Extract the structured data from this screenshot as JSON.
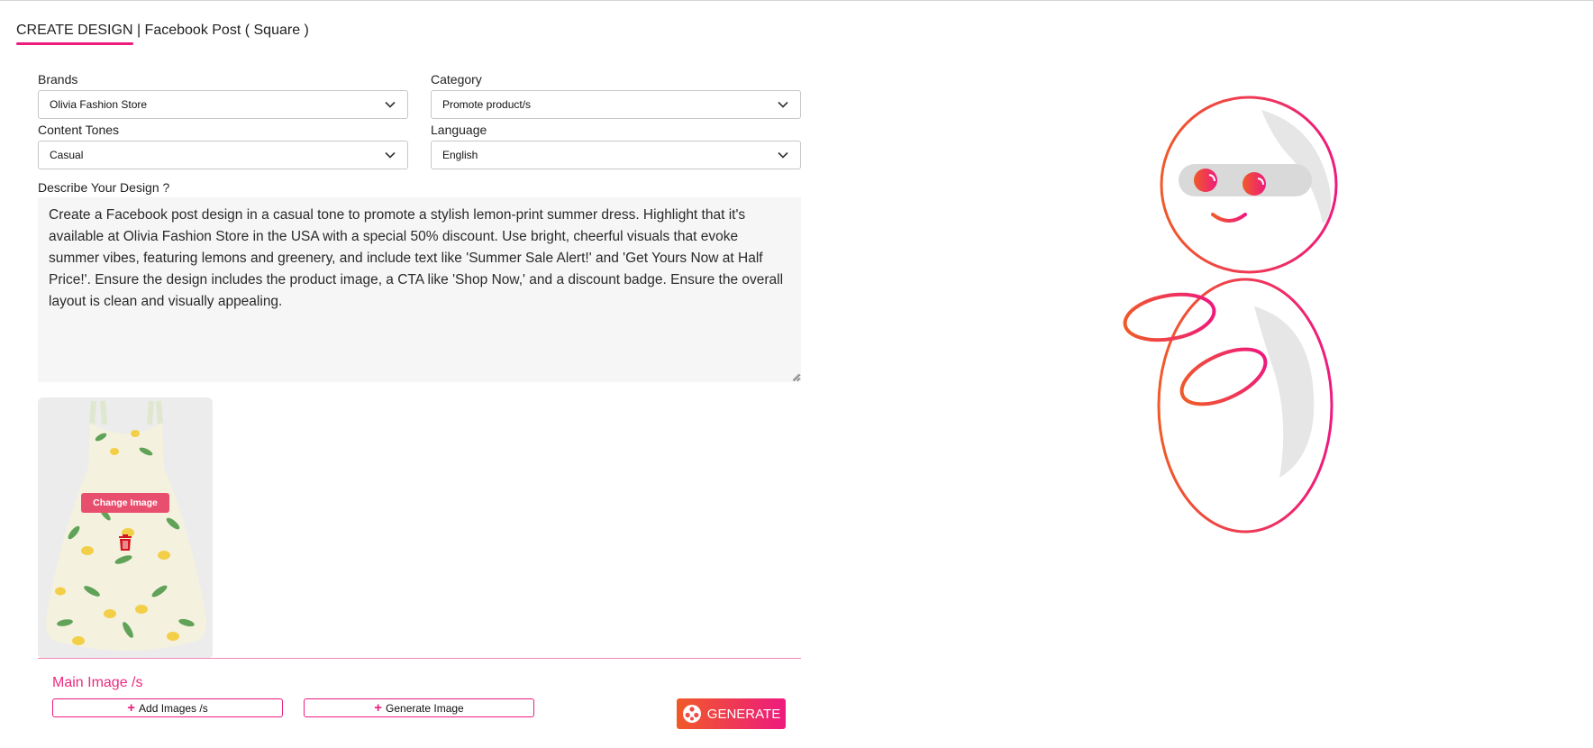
{
  "header": {
    "section_title": "CREATE DESIGN",
    "separator": " | ",
    "subtitle": "Facebook Post ( Square )"
  },
  "form": {
    "brands": {
      "label": "Brands",
      "value": "Olivia Fashion Store"
    },
    "category": {
      "label": "Category",
      "value": "Promote product/s"
    },
    "content_tones": {
      "label": "Content Tones",
      "value": "Casual"
    },
    "language": {
      "label": "Language",
      "value": "English"
    },
    "describe": {
      "label": "Describe Your Design ?",
      "value": "Create a Facebook post design in a casual tone to promote a stylish lemon-print summer dress. Highlight that it's available at Olivia Fashion Store in the USA with a special 50% discount. Use bright, cheerful visuals that evoke summer vibes, featuring lemons and greenery, and include text like 'Summer Sale Alert!' and 'Get Yours Now at Half Price!'. Ensure the design includes the product image, a CTA like 'Shop Now,' and a discount badge. Ensure the overall layout is clean and visually appealing."
    }
  },
  "image_card": {
    "change_image_label": "Change Image",
    "image_icon": "lemon-print-dress-image",
    "delete_icon": "trash-icon"
  },
  "main_images": {
    "label": "Main Image /s",
    "add_images_label": "Add Images /s",
    "generate_image_label": "Generate Image"
  },
  "generate_button": {
    "label": "GENERATE",
    "icon": "film-reel-icon"
  },
  "mascot": {
    "icon": "robot-mascot-illustration"
  },
  "colors": {
    "accent_pink": "#ec1b7d",
    "accent_orange": "#f05a28",
    "change_image_bg": "#e84f6e",
    "textarea_bg": "#f6f6f6"
  }
}
